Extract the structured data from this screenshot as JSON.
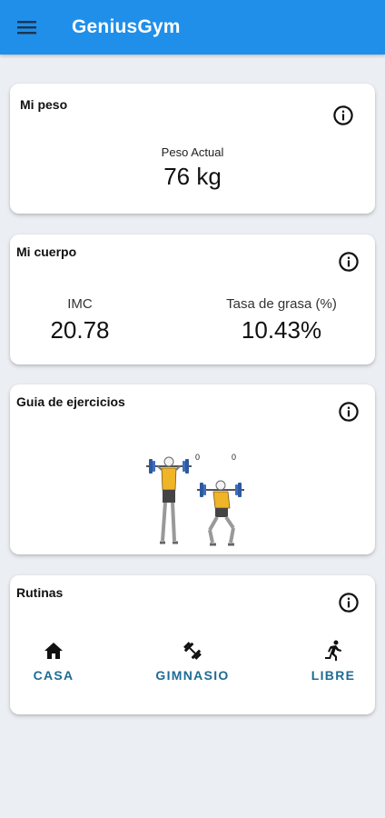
{
  "app": {
    "title": "GeniusGym"
  },
  "colors": {
    "appbar": "#1f8fea",
    "accent": "#1e6b94",
    "background": "#ebeef2"
  },
  "weight_card": {
    "title": "Mi peso",
    "label": "Peso Actual",
    "value": "76 kg",
    "info_icon": "info-circle-icon"
  },
  "body_card": {
    "title": "Mi cuerpo",
    "imc_label": "IMC",
    "imc_value": "20.78",
    "fat_label": "Tasa de grasa (%)",
    "fat_value": "10.43%",
    "info_icon": "info-circle-icon"
  },
  "exercise_card": {
    "title": "Guia de ejercicios",
    "illustration": "barbell-squat-illustration",
    "marker_a": "0",
    "marker_b": "0",
    "info_icon": "info-circle-icon"
  },
  "routines_card": {
    "title": "Rutinas",
    "info_icon": "info-circle-icon",
    "items": [
      {
        "label": "CASA",
        "icon": "home-icon"
      },
      {
        "label": "GIMNASIO",
        "icon": "dumbbell-icon"
      },
      {
        "label": "LIBRE",
        "icon": "running-icon"
      }
    ]
  }
}
